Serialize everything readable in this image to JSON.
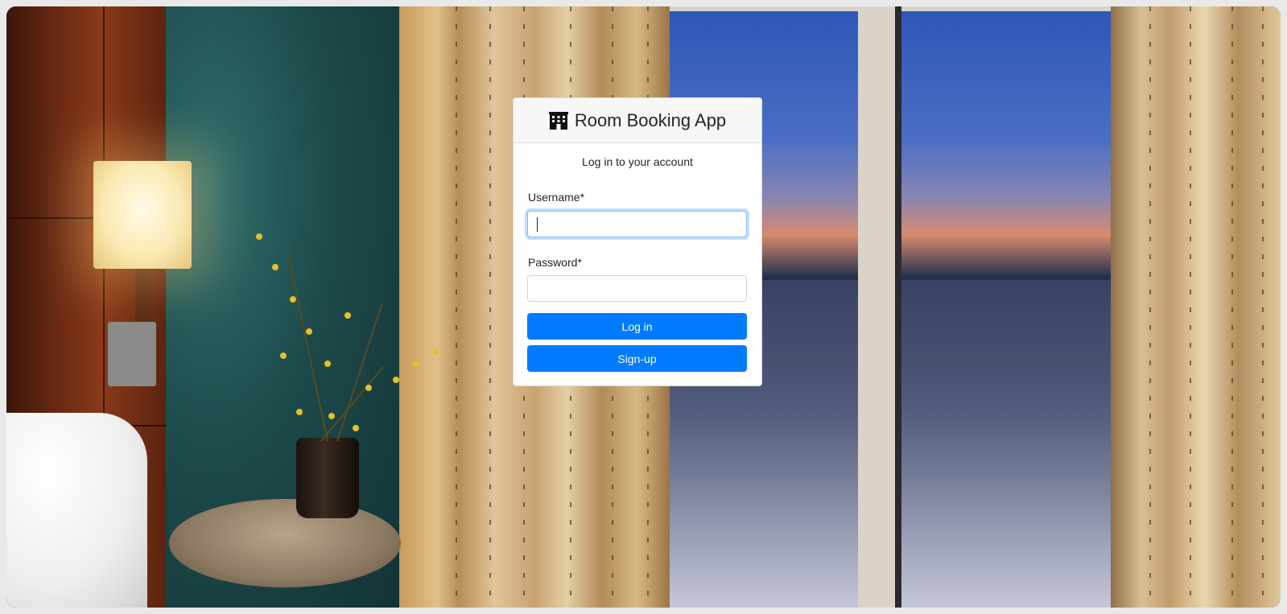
{
  "app": {
    "title": "Room Booking App",
    "icon": "hotel-icon"
  },
  "login": {
    "subtitle": "Log in to your account",
    "username_label": "Username*",
    "username_value": "",
    "password_label": "Password*",
    "password_value": "",
    "login_button": "Log in",
    "signup_button": "Sign-up"
  },
  "colors": {
    "primary": "#007bff",
    "focus_border": "#80bdff",
    "header_bg": "#f7f7f7"
  }
}
